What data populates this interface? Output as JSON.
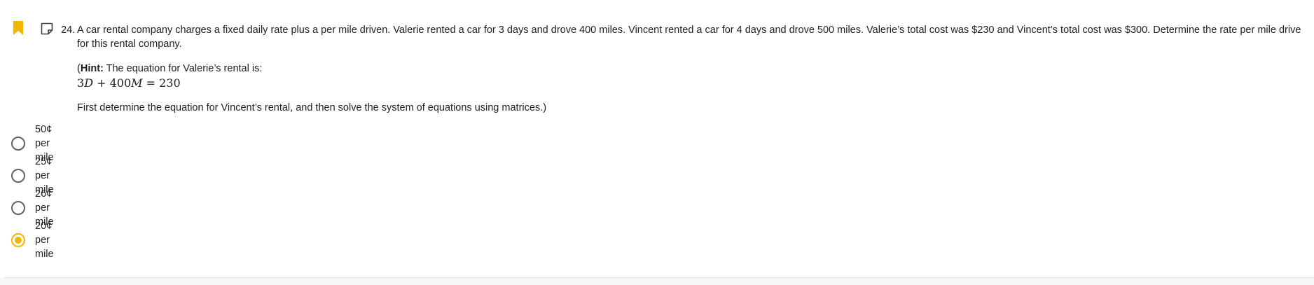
{
  "question": {
    "number": "24.",
    "text": "A car rental company charges a fixed daily rate plus a per mile driven. Valerie rented a car for 3 days and drove 400 miles. Vincent rented a car for 4 days and drove 500 miles. Valerie’s total cost was $230 and Vincent’s total cost was $300. Determine the rate per mile drive for this rental company.",
    "hint_open": "(",
    "hint_label": "Hint:",
    "hint_text": " The equation for Valerie’s rental is:",
    "equation": {
      "coef_d": "3",
      "var_d": "D",
      "plus": " + ",
      "coef_m": "400",
      "var_m": "M",
      "equals": " = ",
      "rhs": "230"
    },
    "followup": "First determine the equation for Vincent’s rental, and then solve the system of equations using matrices.)"
  },
  "options": [
    {
      "label": "50¢ per mile",
      "selected": false
    },
    {
      "label": "25¢ per mile",
      "selected": false
    },
    {
      "label": "26¢ per mile",
      "selected": false
    },
    {
      "label": "20¢ per mile",
      "selected": true
    }
  ],
  "icons": {
    "bookmark": "bookmark-icon",
    "note": "note-icon"
  },
  "colors": {
    "accent": "#f2b600",
    "text": "#1f1f1f",
    "radio_border": "#5f6368",
    "divider": "#e0e0e0"
  }
}
